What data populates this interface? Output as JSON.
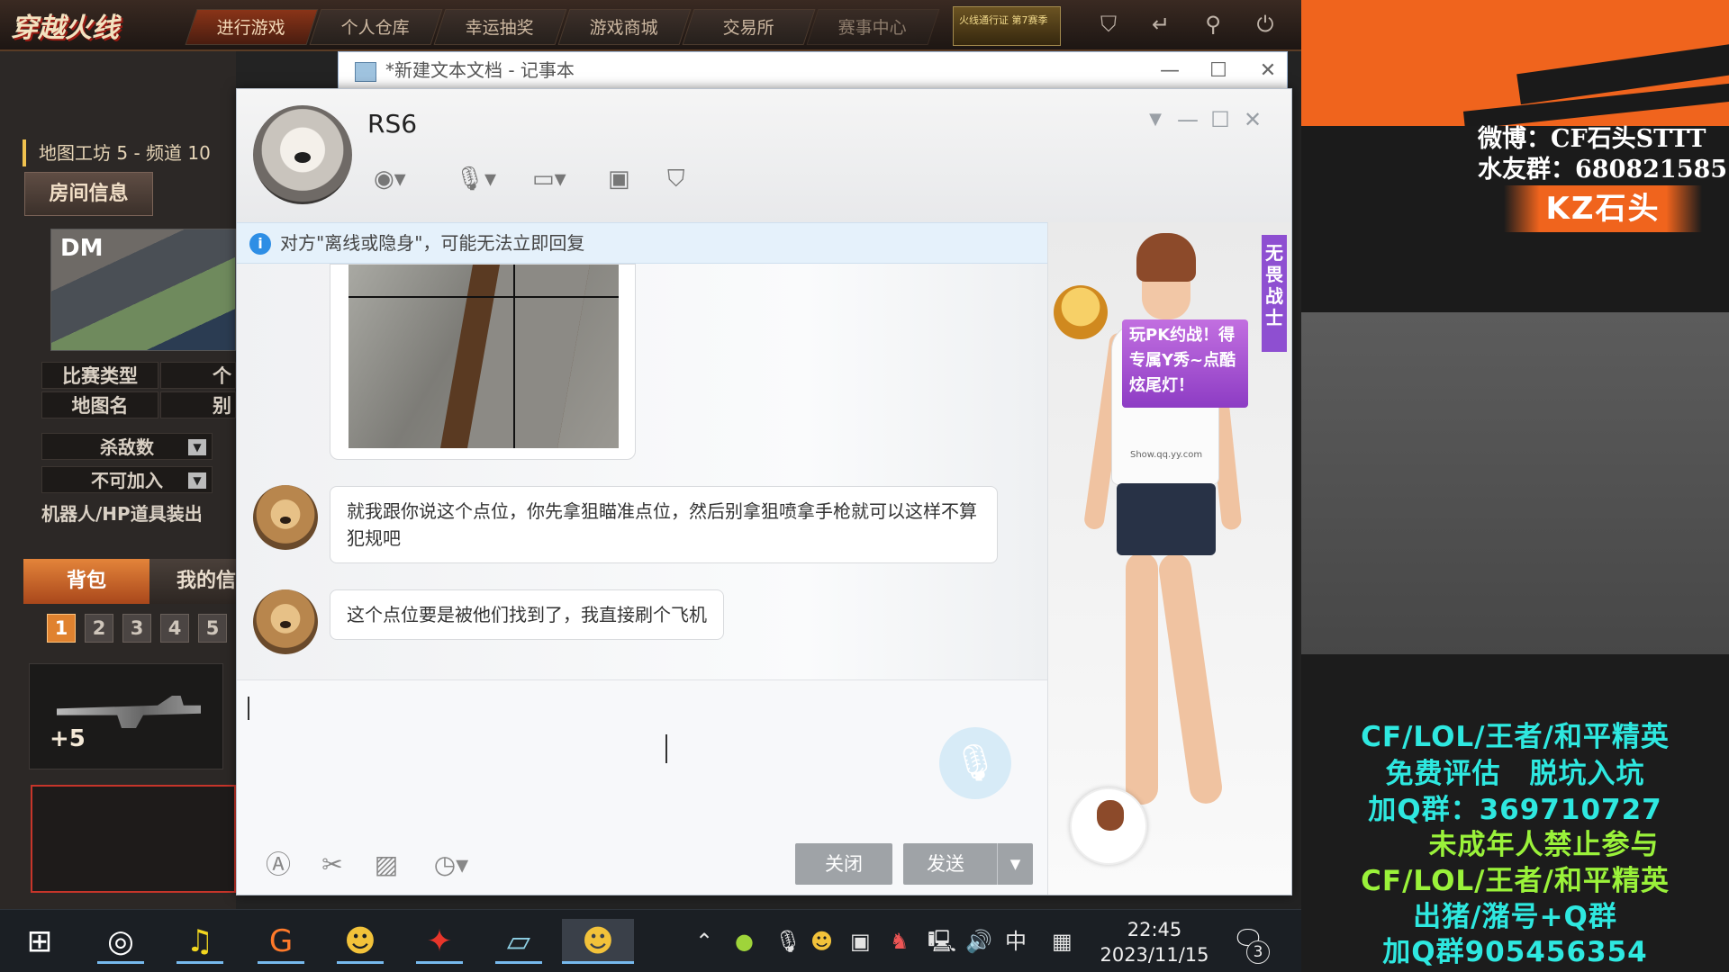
{
  "game": {
    "logo": "穿越火线",
    "nav_tabs": [
      "进行游戏",
      "个人仓库",
      "幸运抽奖",
      "游戏商城",
      "交易所",
      "赛事中心"
    ],
    "badge_text": "火线通行证 第7赛季",
    "map_info": "地图工坊 5 - 频道 10",
    "room_info_button": "房间信息",
    "map_tag": "DM",
    "match_type_label": "比赛类型",
    "match_type_value": "个",
    "map_name_label": "地图名",
    "map_name_value": "别",
    "kills_label": "杀敌数",
    "join_label": "不可加入",
    "robot_label": "机器人/HP道具装出",
    "bag_tab": "背包",
    "my_tab": "我的信",
    "pages": [
      "1",
      "2",
      "3",
      "4",
      "5"
    ],
    "ammo_bonus": "+5"
  },
  "notepad": {
    "title": "*新建文本文档 - 记事本",
    "minimize": "—",
    "maximize": "☐",
    "close": "✕"
  },
  "chat": {
    "contact_name": "RS6",
    "notice": "对方\"离线或隐身\"，可能无法立即回复",
    "messages": [
      {
        "text": "就我跟你说这个点位，你先拿狙瞄准点位，然后别拿狙喷拿手枪就可以这样不算犯规吧"
      },
      {
        "text": "这个点位要是被他们找到了，我直接刷个飞机"
      }
    ],
    "close_button": "关闭",
    "send_button": "发送",
    "promo_text": "玩PK约战！得专属Y秀~点酷炫尾灯！",
    "vertical_tag": "无畏战士",
    "shirt_text": "Show.qq.yy.com"
  },
  "taskbar": {
    "time": "22:45",
    "date": "2023/11/15",
    "ime": "中",
    "notifications": "3"
  },
  "overlay": {
    "weibo": "微博：CF石头STTT",
    "fan_group": "水友群：680821585",
    "streamer": "KZ石头",
    "lines": [
      "CF/LOL/王者/和平精英",
      "免费评估　脱坑入坑",
      "加Q群：369710727",
      "　　未成年人禁止参与",
      "CF/LOL/王者/和平精英",
      "出猪/潴号+Q群",
      "加Q群905456354"
    ],
    "colors": {
      "accent": "#f0641d",
      "cyan": "#2ee8e0",
      "green": "#9af23a"
    }
  }
}
